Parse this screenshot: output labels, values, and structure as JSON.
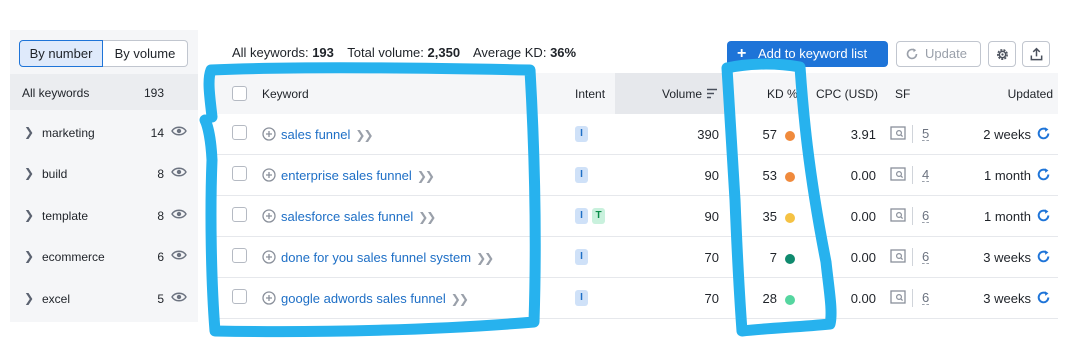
{
  "sidebar": {
    "toggle": {
      "by_number": "By number",
      "by_volume": "By volume"
    },
    "all": {
      "label": "All keywords",
      "count": "193"
    },
    "groups": [
      {
        "label": "marketing",
        "count": "14"
      },
      {
        "label": "build",
        "count": "8"
      },
      {
        "label": "template",
        "count": "8"
      },
      {
        "label": "ecommerce",
        "count": "6"
      },
      {
        "label": "excel",
        "count": "5"
      }
    ]
  },
  "summary": {
    "all_keywords_label": "All keywords:",
    "all_keywords_value": "193",
    "total_volume_label": "Total volume:",
    "total_volume_value": "2,350",
    "avg_kd_label": "Average KD:",
    "avg_kd_value": "36%"
  },
  "toolbar": {
    "add_label": "Add to keyword list",
    "update_label": "Update",
    "settings_icon": "gear-icon",
    "export_icon": "export-icon"
  },
  "table": {
    "headers": {
      "keyword": "Keyword",
      "intent": "Intent",
      "volume": "Volume",
      "kd": "KD %",
      "cpc": "CPC (USD)",
      "sf": "SF",
      "updated": "Updated"
    },
    "rows": [
      {
        "keyword": "sales funnel",
        "intent": [
          "I"
        ],
        "volume": "390",
        "kd": "57",
        "kd_color": "#f08a3c",
        "cpc": "3.91",
        "sf": "5",
        "updated": "2 weeks"
      },
      {
        "keyword": "enterprise sales funnel",
        "intent": [
          "I"
        ],
        "volume": "90",
        "kd": "53",
        "kd_color": "#f08a3c",
        "cpc": "0.00",
        "sf": "4",
        "updated": "1 month"
      },
      {
        "keyword": "salesforce sales funnel",
        "intent": [
          "I",
          "T"
        ],
        "volume": "90",
        "kd": "35",
        "kd_color": "#f5c243",
        "cpc": "0.00",
        "sf": "6",
        "updated": "1 month"
      },
      {
        "keyword": "done for you sales funnel system",
        "intent": [
          "I"
        ],
        "volume": "70",
        "kd": "7",
        "kd_color": "#0f8a6e",
        "cpc": "0.00",
        "sf": "6",
        "updated": "3 weeks"
      },
      {
        "keyword": "google adwords sales funnel",
        "intent": [
          "I"
        ],
        "volume": "70",
        "kd": "28",
        "kd_color": "#55d6a0",
        "cpc": "0.00",
        "sf": "6",
        "updated": "3 weeks"
      }
    ]
  },
  "colors": {
    "accent": "#1e74d8",
    "link": "#1e6fc6",
    "annotation": "#27b2ee"
  }
}
